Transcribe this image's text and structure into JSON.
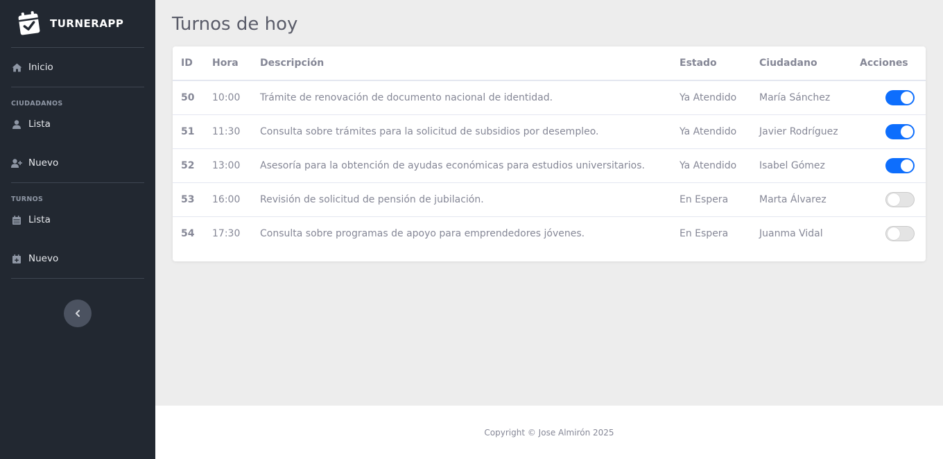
{
  "brand": {
    "name": "TURNERAPP",
    "icon": "calendar-check-icon"
  },
  "sidebar": {
    "home_label": "Inicio",
    "sections": [
      {
        "heading": "CIUDADANOS",
        "items": [
          {
            "label": "Lista",
            "icon": "user-icon"
          },
          {
            "label": "Nuevo",
            "icon": "user-plus-icon"
          }
        ]
      },
      {
        "heading": "TURNOS",
        "items": [
          {
            "label": "Lista",
            "icon": "calendar-icon"
          },
          {
            "label": "Nuevo",
            "icon": "calendar-plus-icon"
          }
        ]
      }
    ],
    "collapse_icon": "chevron-left-icon"
  },
  "main": {
    "title": "Turnos de hoy",
    "table": {
      "headers": [
        "ID",
        "Hora",
        "Descripción",
        "Estado",
        "Ciudadano",
        "Acciones"
      ],
      "rows": [
        {
          "id": "50",
          "hora": "10:00",
          "descripcion": "Trámite de renovación de documento nacional de identidad.",
          "estado": "Ya Atendido",
          "ciudadano": "María Sánchez",
          "attended": true
        },
        {
          "id": "51",
          "hora": "11:30",
          "descripcion": "Consulta sobre trámites para la solicitud de subsidios por desempleo.",
          "estado": "Ya Atendido",
          "ciudadano": "Javier Rodríguez",
          "attended": true
        },
        {
          "id": "52",
          "hora": "13:00",
          "descripcion": "Asesoría para la obtención de ayudas económicas para estudios universitarios.",
          "estado": "Ya Atendido",
          "ciudadano": "Isabel Gómez",
          "attended": true
        },
        {
          "id": "53",
          "hora": "16:00",
          "descripcion": "Revisión de solicitud de pensión de jubilación.",
          "estado": "En Espera",
          "ciudadano": "Marta Álvarez",
          "attended": false
        },
        {
          "id": "54",
          "hora": "17:30",
          "descripcion": "Consulta sobre programas de apoyo para emprendedores jóvenes.",
          "estado": "En Espera",
          "ciudadano": "Juanma Vidal",
          "attended": false
        }
      ]
    }
  },
  "footer": {
    "copyright": "Copyright © Jose Almirón 2025"
  },
  "colors": {
    "sidebar_bg": "#222831",
    "accent": "#0d6efd",
    "page_bg": "#ededed"
  }
}
